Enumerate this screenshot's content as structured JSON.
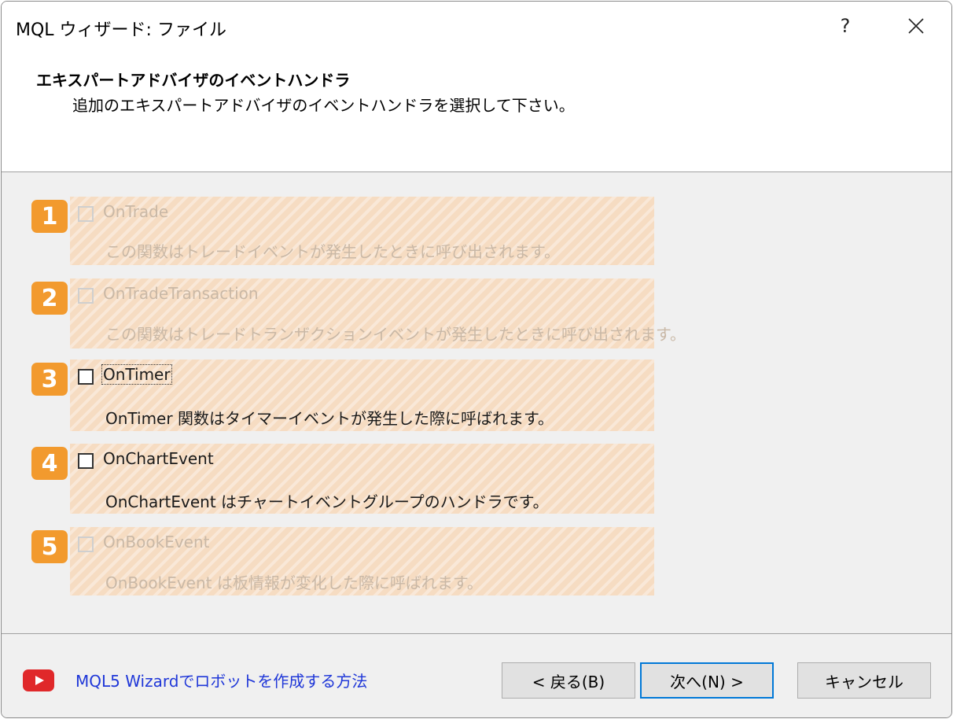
{
  "window": {
    "title": "MQL ウィザード: ファイル",
    "help_label": "?"
  },
  "header": {
    "title": "エキスパートアドバイザのイベントハンドラ",
    "subtitle": "追加のエキスパートアドバイザのイベントハンドラを選択して下さい。"
  },
  "handlers": [
    {
      "number": "1",
      "label": "OnTrade",
      "description": "この関数はトレードイベントが発生したときに呼び出されます。",
      "enabled": false,
      "checked": false
    },
    {
      "number": "2",
      "label": "OnTradeTransaction",
      "description": "この関数はトレードトランザクションイベントが発生したときに呼び出されます。",
      "enabled": false,
      "checked": false
    },
    {
      "number": "3",
      "label": "OnTimer",
      "description": "OnTimer 関数はタイマーイベントが発生した際に呼ばれます。",
      "enabled": true,
      "checked": false
    },
    {
      "number": "4",
      "label": "OnChartEvent",
      "description": "OnChartEvent はチャートイベントグループのハンドラです。",
      "enabled": true,
      "checked": false
    },
    {
      "number": "5",
      "label": "OnBookEvent",
      "description": "OnBookEvent は板情報が変化した際に呼ばれます。",
      "enabled": false,
      "checked": false
    }
  ],
  "footer": {
    "help_link": "MQL5 Wizardでロボットを作成する方法",
    "back_button": "< 戻る(B)",
    "next_button": "次へ(N) >",
    "cancel_button": "キャンセル"
  },
  "colors": {
    "badge": "#f29a2e",
    "handler_bg": "#f6dcc2",
    "link": "#1f37d8",
    "youtube": "#e0282a",
    "primary_border": "#0078d7"
  }
}
